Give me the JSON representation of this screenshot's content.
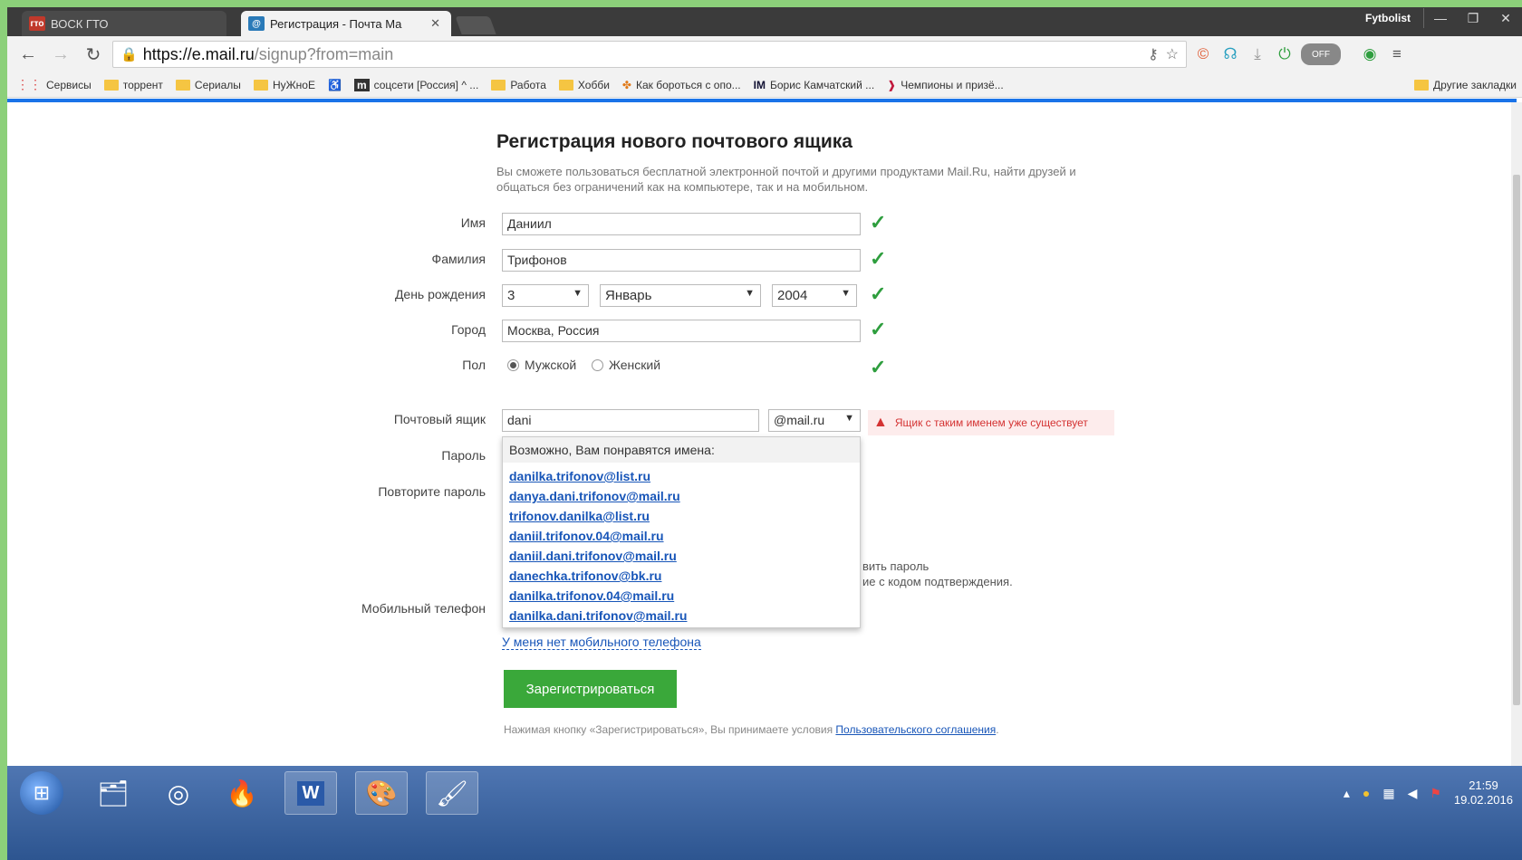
{
  "browser": {
    "tabs": [
      {
        "label": "ВОСК ГТО",
        "favicon": "гто"
      },
      {
        "label": "Регистрация - Почта Ma",
        "favicon": "mail-icon"
      }
    ],
    "profile": "Fytbolist",
    "url_host": "https://e.mail.ru",
    "url_path": "/signup?from=main",
    "bookmarks": [
      "Сервисы",
      "торрент",
      "Сериалы",
      "НуЖноЕ",
      "соцсети [Россия] ^ ...",
      "Работа",
      "Хобби",
      "Как бороться с опо...",
      "Борис Камчатский ...",
      "Чемпионы и призё..."
    ],
    "bookmarks_other": "Другие закладки",
    "ext_toggle": "OFF"
  },
  "form": {
    "title": "Регистрация нового почтового ящика",
    "intro": "Вы сможете пользоваться бесплатной электронной почтой и другими продуктами Mail.Ru, найти друзей и общаться без ограничений как на компьютере, так и на мобильном.",
    "first_name_label": "Имя",
    "first_name_value": "Даниил",
    "last_name_label": "Фамилия",
    "last_name_value": "Трифонов",
    "birthday_label": "День рождения",
    "birthday_day": "3",
    "birthday_month": "Январь",
    "birthday_year": "2004",
    "city_label": "Город",
    "city_value": "Москва, Россия",
    "gender_label": "Пол",
    "gender_male": "Мужской",
    "gender_female": "Женский",
    "mailbox_label": "Почтовый ящик",
    "mailbox_value": "dani",
    "mailbox_domain": "@mail.ru",
    "mailbox_error": "Ящик с таким именем уже существует",
    "password_label": "Пароль",
    "repeat_password_label": "Повторите пароль",
    "behind_text_1": "вить пароль",
    "behind_text_2": "ие с кодом подтверждения.",
    "phone_label": "Мобильный телефон",
    "no_phone_link": "У меня нет мобильного телефона",
    "register_button": "Зарегистрироваться",
    "terms_text": "Нажимая кнопку «Зарегистрироваться», Вы принимаете условия",
    "terms_link": "Пользовательского соглашения",
    "terms_end": "."
  },
  "suggestions": {
    "header": "Возможно, Вам понравятся имена:",
    "items": [
      "danilka.trifonov@list.ru",
      "danya.dani.trifonov@mail.ru",
      "trifonov.danilka@list.ru",
      "daniil.trifonov.04@mail.ru",
      "daniil.dani.trifonov@mail.ru",
      "danechka.trifonov@bk.ru",
      "danilka.trifonov.04@mail.ru",
      "danilka.dani.trifonov@mail.ru"
    ]
  },
  "taskbar": {
    "time": "21:59",
    "date": "19.02.2016"
  },
  "colors": {
    "accent_green": "#3aa83a",
    "check_green": "#2e9e3e",
    "link_blue": "#1755b8",
    "error_red": "#d43333"
  }
}
